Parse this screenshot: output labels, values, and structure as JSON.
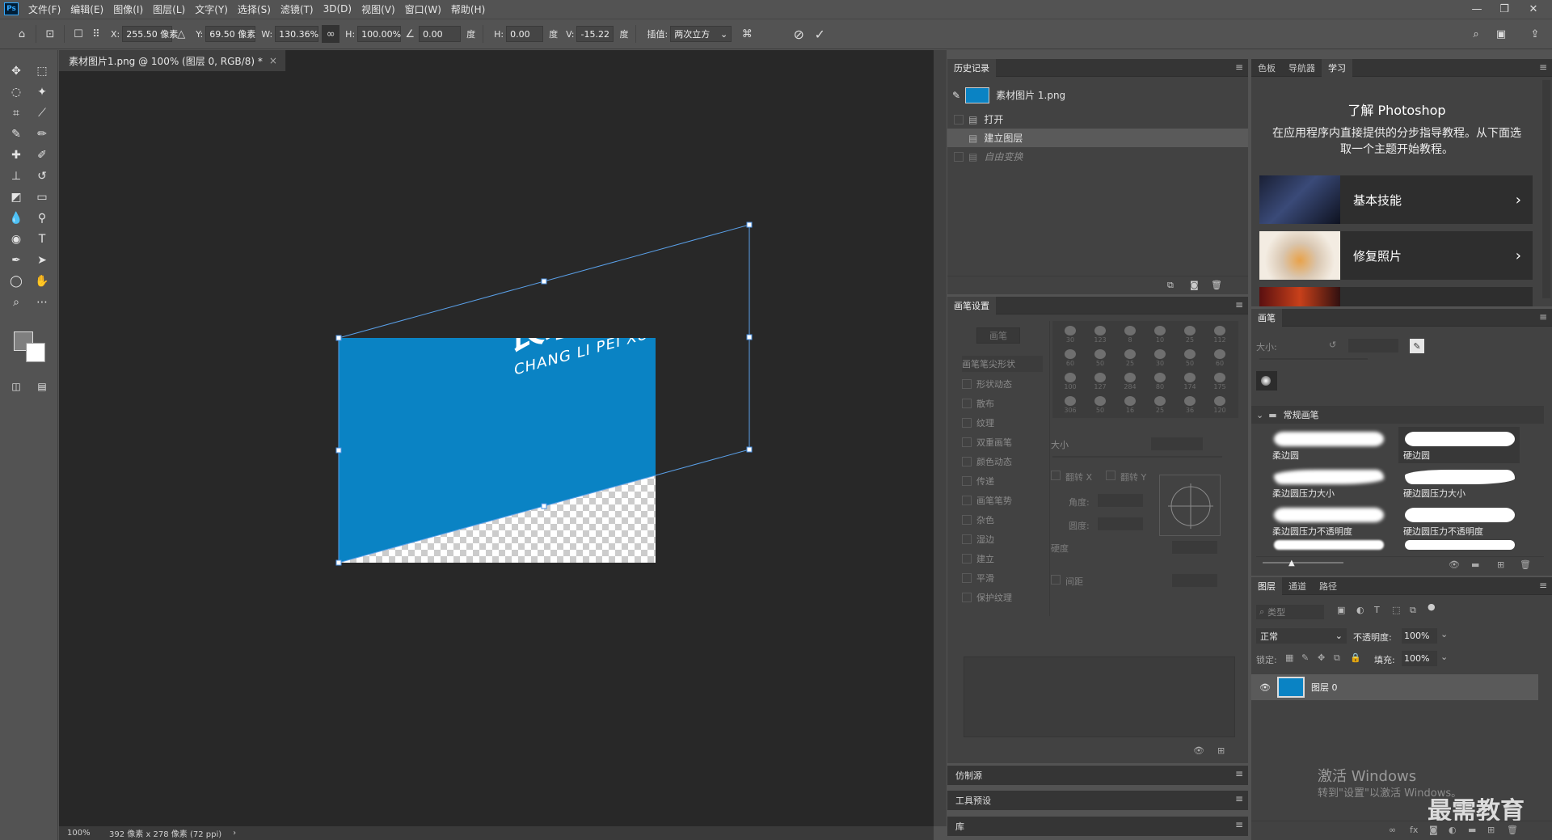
{
  "app": {
    "logo": "Ps",
    "menu": [
      "文件(F)",
      "编辑(E)",
      "图像(I)",
      "图层(L)",
      "文字(Y)",
      "选择(S)",
      "滤镜(T)",
      "3D(D)",
      "视图(V)",
      "窗口(W)",
      "帮助(H)"
    ]
  },
  "options": {
    "x_label": "X:",
    "x_value": "255.50 像素",
    "y_label": "Y:",
    "y_value": "69.50 像素",
    "w_label": "W:",
    "w_value": "130.36%",
    "h_label": "H:",
    "h_value": "100.00%",
    "angle_value": "0.00",
    "deg": "度",
    "skew_h_label": "H:",
    "skew_h_value": "0.00",
    "skew_v_label": "V:",
    "skew_v_value": "-15.22",
    "interp_label": "插值:",
    "interp_value": "两次立方"
  },
  "document": {
    "tab_title": "素材图片1.png @ 100% (图层 0, RGB/8) *",
    "close": "×",
    "zoom": "100%",
    "size_info": "392 像素 x 278 像素 (72 ppi)",
    "status_arrow": "›",
    "title_cn": "长理培训",
    "subtitle": "CHANG LI PEI XUN",
    "brand_color": "#0a83c4"
  },
  "history": {
    "tab": "历史记录",
    "source": "素材图片 1.png",
    "items": [
      "打开",
      "建立图层",
      "自由变换"
    ]
  },
  "brush_settings": {
    "tab": "画笔设置",
    "brush_button": "画笔",
    "tip_shape": "画笔笔尖形状",
    "options": [
      "形状动态",
      "散布",
      "纹理",
      "双重画笔",
      "颜色动态",
      "传递",
      "画笔笔势",
      "杂色",
      "湿边",
      "建立",
      "平滑",
      "保护纹理"
    ],
    "size_label": "大小",
    "flip_x": "翻转 X",
    "flip_y": "翻转 Y",
    "angle_label": "角度:",
    "roundness_label": "圆度:",
    "hardness_label": "硬度",
    "spacing_label": "间距",
    "preset_sizes": [
      "30",
      "123",
      "8",
      "10",
      "25",
      "112",
      "60",
      "50",
      "25",
      "30",
      "50",
      "60",
      "100",
      "127",
      "284",
      "80",
      "174",
      "175",
      "306",
      "50",
      "16",
      "25",
      "36",
      "120"
    ]
  },
  "learn": {
    "tabs": [
      "色板",
      "导航器",
      "学习"
    ],
    "title": "了解 Photoshop",
    "desc": "在应用程序内直接提供的分步指导教程。从下面选取一个主题开始教程。",
    "cards": [
      "基本技能",
      "修复照片"
    ]
  },
  "brushes": {
    "tab": "画笔",
    "size_label": "大小:",
    "group": "常规画笔",
    "items": [
      "柔边圆",
      "硬边圆",
      "柔边圆压力大小",
      "硬边圆压力大小",
      "柔边圆压力不透明度",
      "硬边圆压力不透明度"
    ]
  },
  "layers": {
    "tabs": [
      "图层",
      "通道",
      "路径"
    ],
    "filter_placeholder": "类型",
    "blend": "正常",
    "opacity_label": "不透明度:",
    "opacity": "100%",
    "lock_label": "锁定:",
    "fill_label": "填充:",
    "fill": "100%",
    "layer_name": "图层 0"
  },
  "collapsed": [
    "仿制源",
    "工具预设",
    "库"
  ],
  "watermark": {
    "line1": "激活 Windows",
    "line2": "转到\"设置\"以激活 Windows。",
    "brand": "最需教育"
  }
}
